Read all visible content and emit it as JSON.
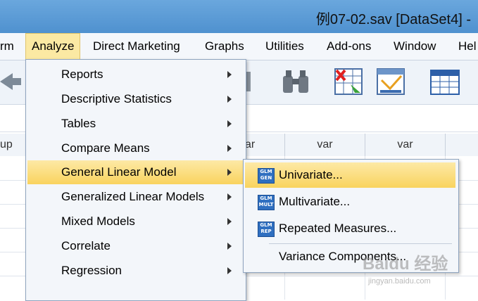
{
  "window": {
    "title": "例07-02.sav [DataSet4] -"
  },
  "menubar": {
    "items": [
      {
        "label": "rm"
      },
      {
        "label": "Analyze"
      },
      {
        "label": "Direct Marketing"
      },
      {
        "label": "Graphs"
      },
      {
        "label": "Utilities"
      },
      {
        "label": "Add-ons"
      },
      {
        "label": "Window"
      },
      {
        "label": "Hel"
      }
    ]
  },
  "grid": {
    "columns": [
      {
        "label": "up"
      },
      {
        "label": "ar"
      },
      {
        "label": "var"
      },
      {
        "label": "var"
      }
    ]
  },
  "analyze_menu": {
    "items": [
      {
        "label": "Reports"
      },
      {
        "label": "Descriptive Statistics"
      },
      {
        "label": "Tables"
      },
      {
        "label": "Compare Means"
      },
      {
        "label": "General Linear Model"
      },
      {
        "label": "Generalized Linear Models"
      },
      {
        "label": "Mixed Models"
      },
      {
        "label": "Correlate"
      },
      {
        "label": "Regression"
      }
    ]
  },
  "glm_submenu": {
    "items": [
      {
        "label": "Univariate...",
        "icon_text": "GLM GEN"
      },
      {
        "label": "Multivariate...",
        "icon_text": "GLM MULT"
      },
      {
        "label": "Repeated Measures...",
        "icon_text": "GLM REP"
      },
      {
        "label": "Variance Components..."
      }
    ]
  },
  "watermark": {
    "text": "Baidu 经验",
    "sub": "jingyan.baidu.com"
  },
  "colors": {
    "highlight": "#f9d35e",
    "titlebar": "#5b9bd5",
    "menu_bg": "#f3f6fa"
  }
}
